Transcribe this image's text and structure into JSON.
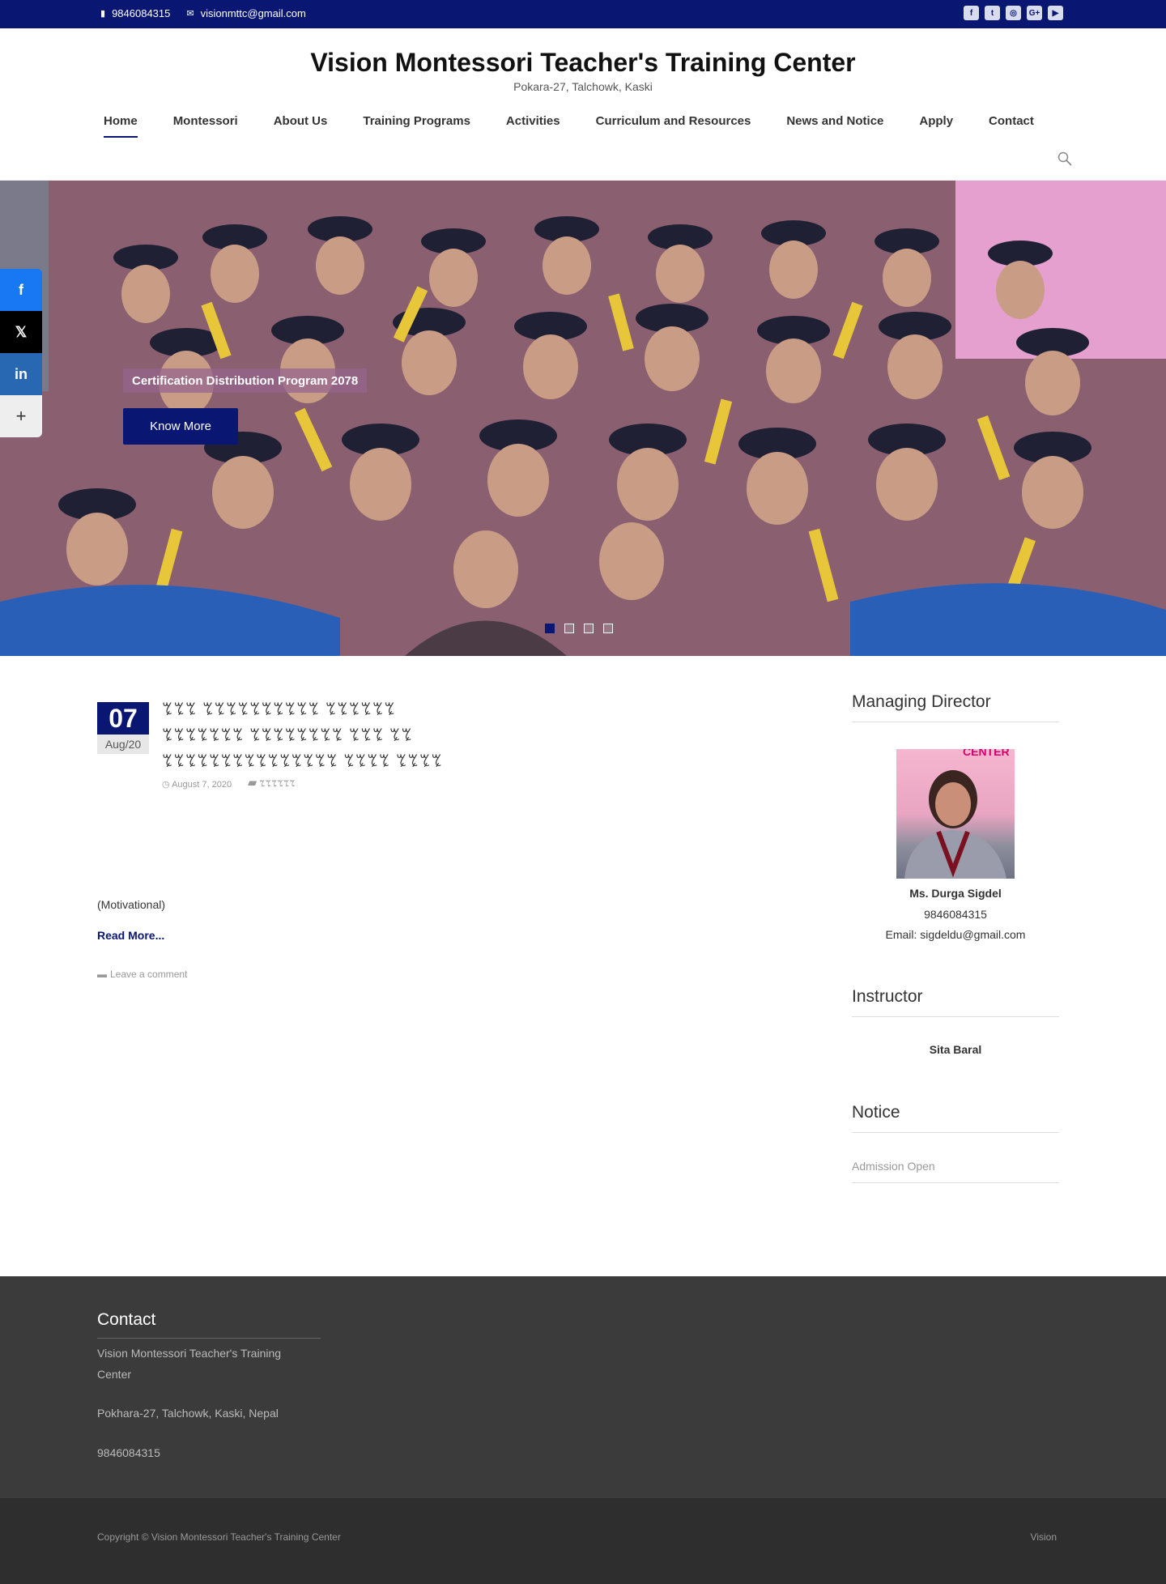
{
  "topbar": {
    "phone": "9846084315",
    "email": "visionmttc@gmail.com",
    "social_icons": [
      "facebook-icon",
      "twitter-icon",
      "instagram-icon",
      "google-plus-icon",
      "youtube-icon"
    ],
    "social_glyphs": [
      "f",
      "t",
      "◎",
      "G+",
      "▶"
    ]
  },
  "header": {
    "site_title": "Vision Montessori Teacher's Training Center",
    "tagline": "Pokara-27, Talchowk, Kaski"
  },
  "nav": {
    "items": [
      "Home",
      "Montessori",
      "About Us",
      "Training Programs",
      "Activities",
      "Curriculum and Resources",
      "News and Notice",
      "Apply",
      "Contact"
    ],
    "active": "Home"
  },
  "hero": {
    "caption": "Certification Distribution Program 2078",
    "button_label": "Know More",
    "slide_count": 4,
    "active_slide": 1
  },
  "share": {
    "icons": [
      "facebook-icon",
      "x-icon",
      "linkedin-icon",
      "more-icon"
    ],
    "glyphs": [
      "f",
      "𝕏",
      "in",
      "+"
    ]
  },
  "post": {
    "day": "07",
    "month": "Aug/20",
    "title": "ꔂꔂꔂ ꔂꔂꔂꔂꔂꔂꔂꔂꔂꔂ ꔂꔂꔂꔂꔂꔂ ꔂꔂꔂꔂꔂꔂꔂ ꔂꔂꔂꔂꔂꔂꔂꔂ ꔂꔂꔂ ꔂꔂ ꔂꔂꔂꔂꔂꔂꔂꔂꔂꔂꔂꔂꔂꔂꔂ ꔂꔂꔂꔂ ꔂꔂꔂꔂ",
    "date": "August 7, 2020",
    "category": "ꔂꔂꔂꔂꔂꔂ",
    "excerpt": "(Motivational)",
    "read_more": "Read More...",
    "comment": "Leave a comment"
  },
  "sidebar": {
    "director_title": "Managing Director",
    "director_name": "Ms. Durga Sigdel",
    "director_phone": "9846084315",
    "director_email": "Email: sigdeldu@gmail.com",
    "photo_banner_text": "CENTER",
    "instructor_title": "Instructor",
    "instructor_name": "Sita Baral",
    "notice_title": "Notice",
    "notice_item": "Admission Open"
  },
  "footer": {
    "title": "Contact",
    "org": "Vision Montessori Teacher's Training Center",
    "address": "Pokhara-27, Talchowk, Kaski, Nepal",
    "phone": "9846084315",
    "copyright": "Copyright © Vision Montessori Teacher's Training Center",
    "credit": "Vision"
  },
  "colors": {
    "brand": "#0a1772",
    "footer": "#3b3b3b",
    "bottombar": "#2e2e2e"
  }
}
